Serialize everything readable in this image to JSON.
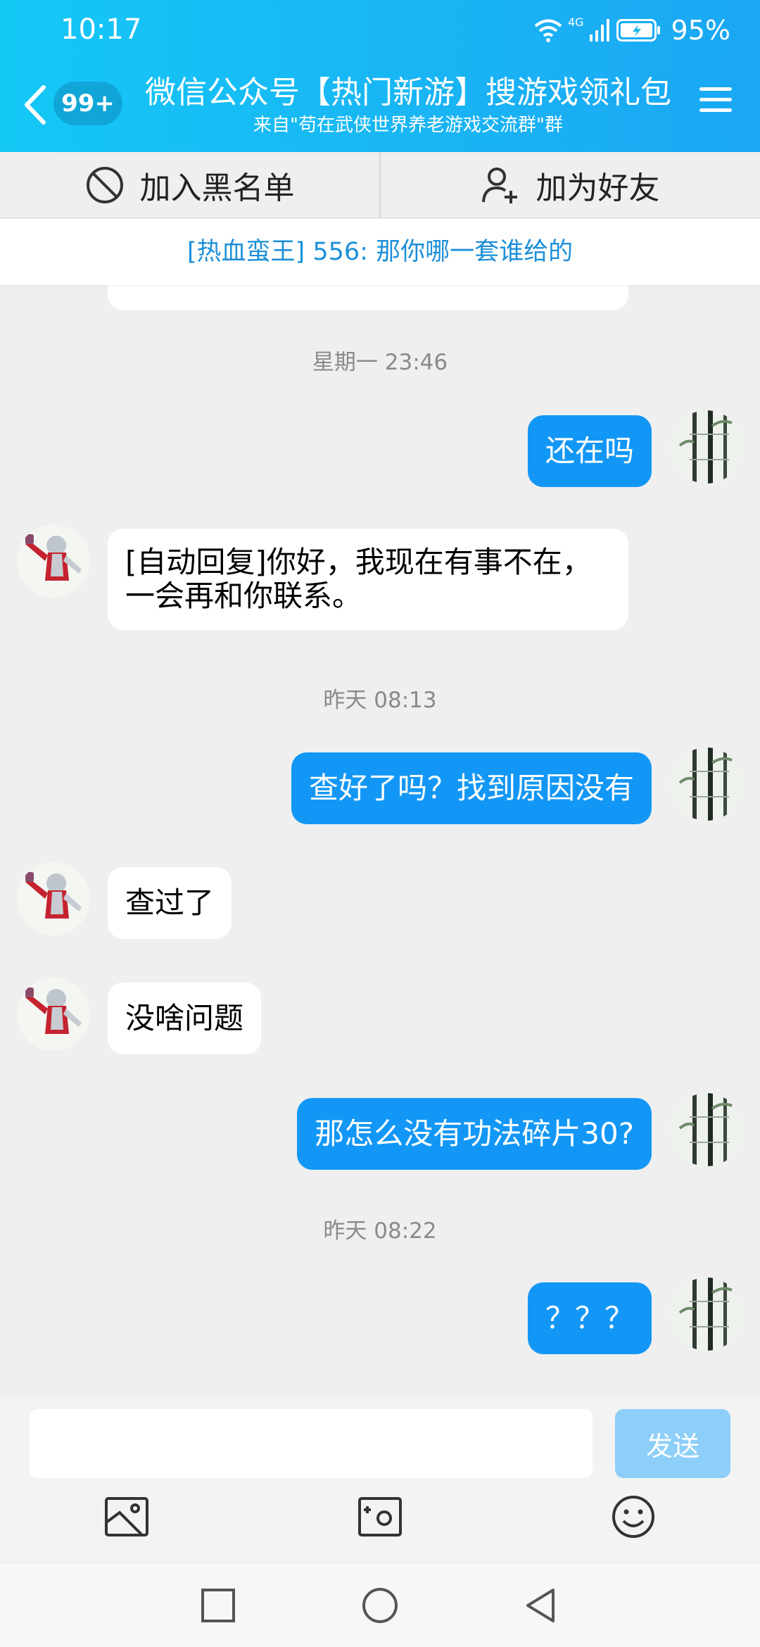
{
  "status_bar": {
    "time": "10:17",
    "network": "4G",
    "battery_percent": "95%",
    "icons": [
      "wifi-icon",
      "signal-icon",
      "battery-charging-icon"
    ]
  },
  "header": {
    "unread_count": "99+",
    "title": "微信公众号【热门新游】搜游戏领礼包",
    "subtitle": "来自\"苟在武侠世界养老游戏交流群\"群",
    "accent_color": "#19b5f4"
  },
  "actions": {
    "blacklist_label": "加入黑名单",
    "add_friend_label": "加为好友"
  },
  "notice": {
    "text": "[热血蛮王] 556: 那你哪一套谁给的"
  },
  "messages": {
    "ts1": "星期一 23:46",
    "m1": "还在吗",
    "m2": "[自动回复]你好，我现在有事不在，一会再和你联系。",
    "ts2": "昨天 08:13",
    "m3": "查好了吗？找到原因没有",
    "m4": "查过了",
    "m5": "没啥问题",
    "m6": "那怎么没有功法碎片30?",
    "ts3": "昨天 08:22",
    "m7": "？？？",
    "bubble_out_color": "#1397f6",
    "bubble_in_color": "#ffffff"
  },
  "input": {
    "value": "",
    "send_label": "发送"
  }
}
